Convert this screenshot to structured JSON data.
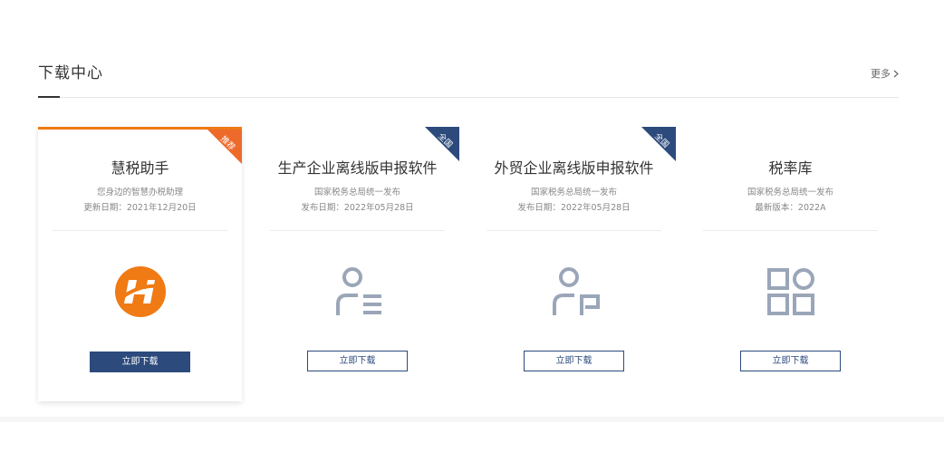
{
  "section": {
    "title": "下载中心",
    "more_label": "更多"
  },
  "cards": [
    {
      "title": "慧税助手",
      "subtitle": "您身边的智慧办税助理",
      "date": "更新日期：2021年12月20日",
      "badge": "推荐",
      "button": "立即下载",
      "icon": "huishui-logo-icon"
    },
    {
      "title": "生产企业离线版申报软件",
      "subtitle": "国家税务总局统一发布",
      "date": "发布日期：2022年05月28日",
      "badge": "全国",
      "button": "立即下载",
      "icon": "user-list-icon"
    },
    {
      "title": "外贸企业离线版申报软件",
      "subtitle": "国家税务总局统一发布",
      "date": "发布日期：2022年05月28日",
      "badge": "全国",
      "button": "立即下载",
      "icon": "user-card-icon"
    },
    {
      "title": "税率库",
      "subtitle": "国家税务总局统一发布",
      "date": "最新版本：2022A",
      "button": "立即下载",
      "icon": "apps-grid-icon"
    }
  ],
  "colors": {
    "accent_orange": "#f07a13",
    "navy": "#2c4a7c",
    "icon_gray": "#9aa6b8"
  }
}
